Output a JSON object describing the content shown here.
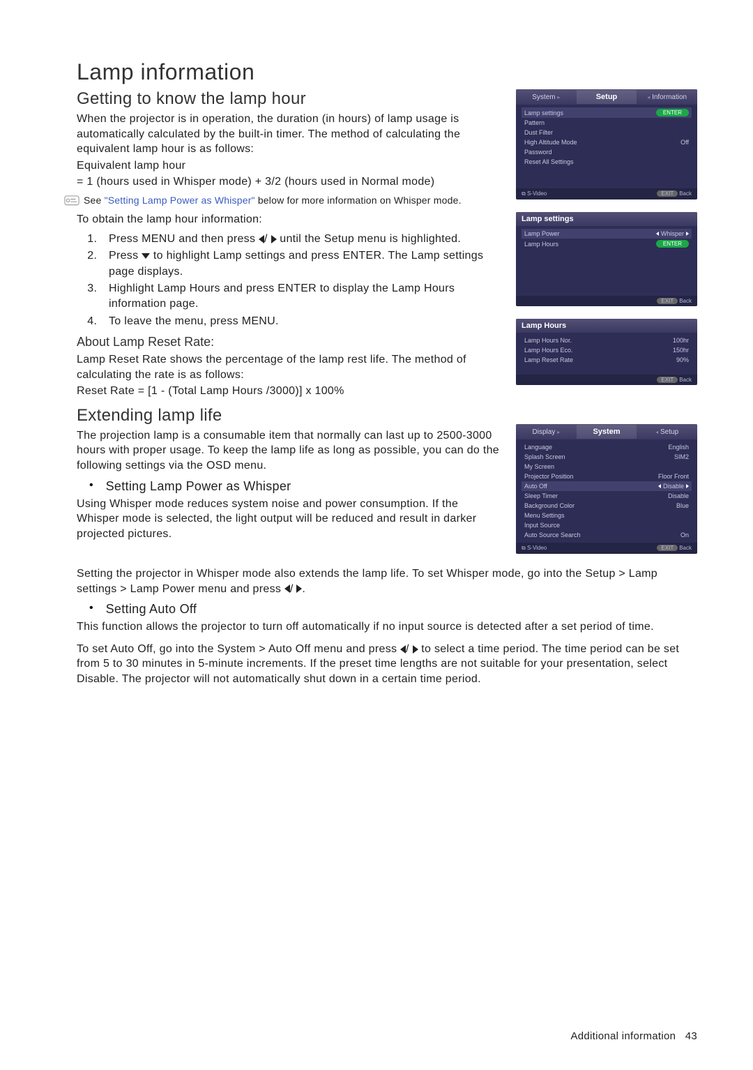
{
  "h1": "Lamp information",
  "sec1": {
    "h2": "Getting to know the lamp hour",
    "p1": "When the projector is in operation, the duration (in hours) of lamp usage is automatically calculated by the built-in timer. The method of calculating the equivalent lamp hour is as follows:",
    "p2": "Equivalent lamp hour",
    "p3": "= 1 (hours used in Whisper mode) + 3/2 (hours used in Normal mode)",
    "note_prefix": "See ",
    "note_link": "\"Setting Lamp Power as Whisper\"",
    "note_suffix": " below for more information on Whisper mode.",
    "p4": "To obtain the lamp hour information:",
    "li1a": "Press MENU and then press ",
    "li1b": " until the Setup menu is highlighted.",
    "li2a": "Press ",
    "li2b": " to highlight Lamp settings and press ENTER. The Lamp settings page displays.",
    "li3": "Highlight Lamp Hours and press ENTER to display the Lamp Hours information page.",
    "li4": "To leave the menu, press MENU.",
    "sub1": "About Lamp Reset Rate:",
    "p5": "Lamp Reset Rate shows the percentage of the lamp rest life. The method of calculating the rate is as follows:",
    "p6": "Reset Rate = [1 - (Total Lamp Hours /3000)] x 100%"
  },
  "sec2": {
    "h2": "Extending lamp life",
    "p1": "The projection lamp is a consumable item that normally can last up to 2500-3000 hours with proper usage. To keep the lamp life as long as possible, you can do the following settings via the OSD menu.",
    "b1": "Setting Lamp Power as Whisper",
    "p2": "Using Whisper mode reduces system noise and power consumption. If the Whisper mode is selected, the light output will be reduced and result in darker projected pictures.",
    "p3a": "Setting the projector in Whisper mode also extends the lamp life. To set Whisper mode, go into the Setup > Lamp settings > Lamp Power menu and press ",
    "p3b": ".",
    "b2": "Setting Auto Off",
    "p4": "This function allows the projector to turn off automatically if no input source is detected after a set period of time.",
    "p5a": "To set Auto Off, go into the System > Auto Off menu and press ",
    "p5b": " to select a time period. The time period can be set from 5 to 30 minutes in 5-minute increments. If the preset time lengths are not suitable for your presentation, select Disable. The projector will not automatically shut down in a certain time period."
  },
  "shots": {
    "setup": {
      "tab1": "System",
      "tab2": "Setup",
      "tab3": "Information",
      "r1": "Lamp settings",
      "r1v": "ENTER",
      "r2": "Pattern",
      "r3": "Dust Filter",
      "r4": "High Altitude Mode",
      "r4v": "Off",
      "r5": "Password",
      "r6": "Reset All Settings",
      "foot_l": "S-Video",
      "foot_r": "Back",
      "exit": "EXIT"
    },
    "lampset": {
      "title": "Lamp settings",
      "r1": "Lamp Power",
      "r1v": "Whisper",
      "r2": "Lamp Hours",
      "r2v": "ENTER",
      "foot_r": "Back",
      "exit": "EXIT"
    },
    "lamphours": {
      "title": "Lamp Hours",
      "r1": "Lamp Hours Nor.",
      "r1v": "100hr",
      "r2": "Lamp Hours Eco.",
      "r2v": "150hr",
      "r3": "Lamp Reset Rate",
      "r3v": "90%",
      "foot_r": "Back",
      "exit": "EXIT"
    },
    "system": {
      "tab1": "Display",
      "tab2": "System",
      "tab3": "Setup",
      "r1": "Language",
      "r1v": "English",
      "r2": "Splash Screen",
      "r2v": "SIM2",
      "r3": "My Screen",
      "r4": "Projector Position",
      "r4v": "Floor Front",
      "r5": "Auto Off",
      "r5v": "Disable",
      "r6": "Sleep Timer",
      "r6v": "Disable",
      "r7": "Background Color",
      "r7v": "Blue",
      "r8": "Menu Settings",
      "r9": "Input Source",
      "r10": "Auto Source Search",
      "r10v": "On",
      "foot_l": "S-Video",
      "foot_r": "Back",
      "exit": "EXIT"
    }
  },
  "footer_text": "Additional information",
  "footer_page": "43"
}
